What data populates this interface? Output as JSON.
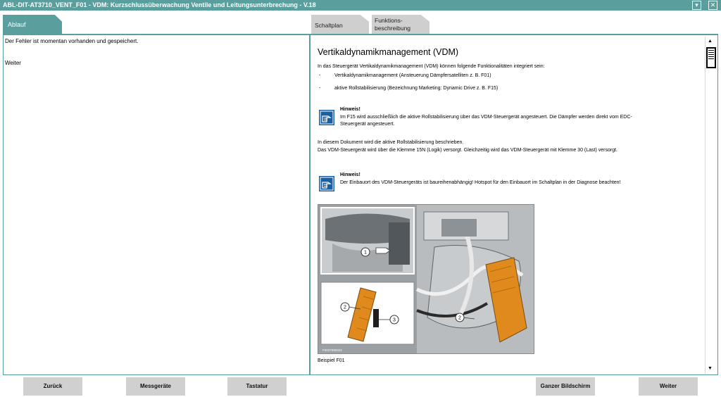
{
  "window": {
    "title": "ABL-DIT-AT3710_VENT_F01 - VDM: Kurzschlussüberwachung Ventile und Leitungsunterbrechung - V.18",
    "minimize_glyph": "▾",
    "close_glyph": "✕"
  },
  "tabs": {
    "left_tab": "Ablauf",
    "schaltplan": "Schaltplan",
    "funktion_line1": "Funktions-",
    "funktion_line2": "beschreibung"
  },
  "left_panel": {
    "line1": "Der Fehler ist momentan vorhanden und gespeichert.",
    "line2": "Weiter"
  },
  "document": {
    "title": "Vertikaldynamikmanagement (VDM)",
    "intro": "In das Steuergerät Vertikaldynamikmanagement (VDM) können folgende Funktionalitäten integriert sein:",
    "bullets": [
      "Vertikaldynamikmanagement (Ansteuerung Dämpfersatelliten z. B. F01)",
      "aktive Rollstabilisierung (Bezeichnung Marketing: Dynamic Drive z. B. F15)"
    ],
    "bullet_marker": "-",
    "note1": {
      "heading": "Hinweis!",
      "text": "Im F15 wird ausschließlich die aktive Rollstabilisierung über das VDM-Steuergerät angesteuert. Die Dämpfer werden direkt vom EDC-Steuergerät angesteuert."
    },
    "para2_line1": "In diesem Dokument wird die aktive Rollstabilisierung beschrieben.",
    "para2_line2": "Das VDM-Steuergerät wird über die Klemme 15N (Logik) versorgt. Gleichzeitig wird das VDM-Steuergerät mit Klemme 30 (Last) versorgt.",
    "note2": {
      "heading": "Hinweis!",
      "text": "Der Einbauort des VDM-Steuergeräts ist baureihenabhängig! Hotspot für den Einbauort im Schaltplan in der Diagnose beachten!"
    },
    "figure": {
      "callout_1": "1",
      "callout_2a": "2",
      "callout_2b": "2",
      "callout_3": "3",
      "image_code": "F0037090322"
    },
    "caption": "Beispiel F01"
  },
  "scrollbar": {
    "up_glyph": "▲",
    "down_glyph": "▼"
  },
  "footer": {
    "back": "Zurück",
    "measure": "Messgeräte",
    "keyboard": "Tastatur",
    "fullscreen": "Ganzer Bildschirm",
    "next": "Weiter"
  },
  "colors": {
    "accent": "#5a9e9e",
    "note_icon": "#1a5fa0",
    "button_bg": "#d0d0d0",
    "part_orange": "#e08a1e"
  }
}
